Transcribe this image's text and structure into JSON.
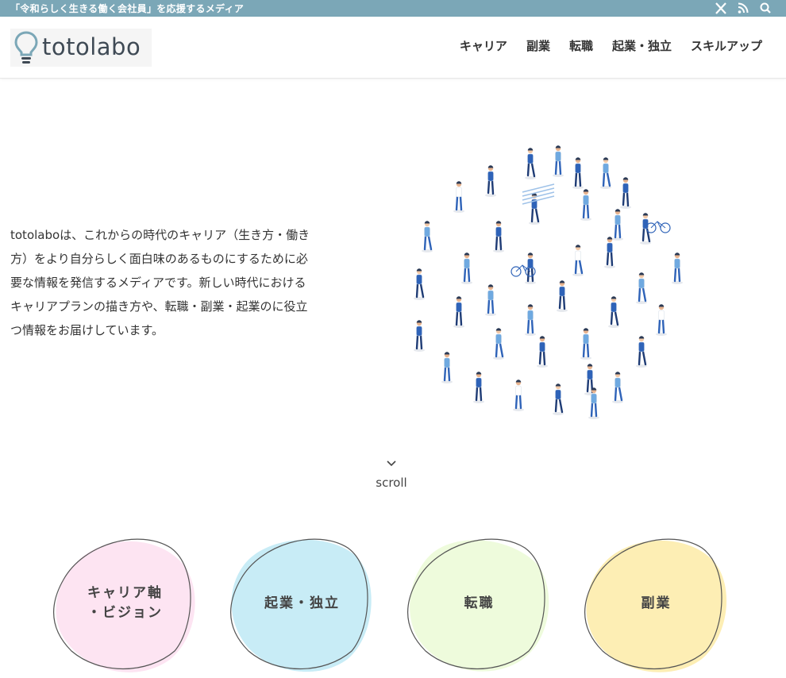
{
  "topbar": {
    "tagline": "「令和らしく生きる働く会社員」を応援するメディア",
    "icons": [
      "x-icon",
      "rss-icon",
      "search-icon"
    ]
  },
  "header": {
    "logo_text": "totolabo",
    "nav": [
      "キャリア",
      "副業",
      "転職",
      "起業・独立",
      "スキルアップ"
    ]
  },
  "intro": {
    "text": "totolaboは、これからの時代のキャリア（生き方・働き方）をより自分らしく面白味のあるものにするために必要な情報を発信するメディアです。新しい時代におけるキャリアプランの描き方や、転職・副業・起業のに役立つ情報をお届けしています。"
  },
  "scroll": {
    "label": "scroll"
  },
  "categories": [
    {
      "label": "キャリア軸\n・ビジョン",
      "color": "#fde4f2"
    },
    {
      "label": "起業・独立",
      "color": "#c8ecf6"
    },
    {
      "label": "転職",
      "color": "#eefbdc"
    },
    {
      "label": "副業",
      "color": "#fdeeb4"
    }
  ],
  "colors": {
    "topbar": "#7ba7b7",
    "people_primary": "#2f63b8",
    "people_light": "#6fa9e0"
  }
}
